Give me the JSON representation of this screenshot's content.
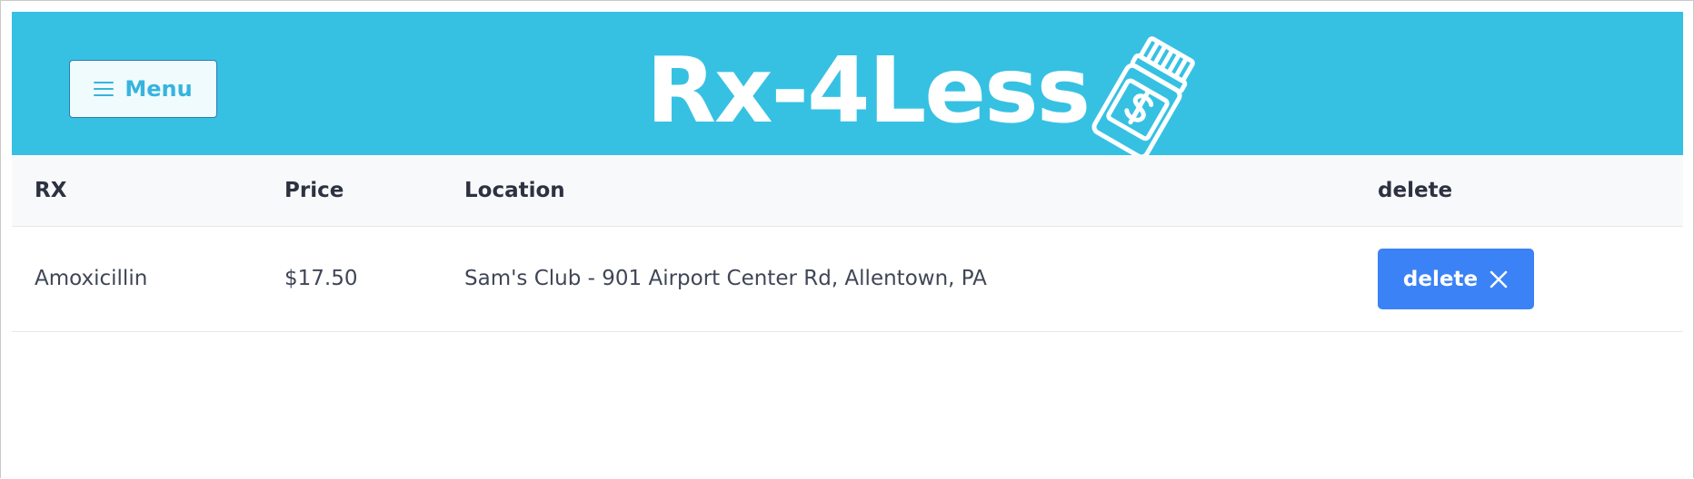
{
  "header": {
    "menu_label": "Menu",
    "brand_title": "Rx-4Less",
    "brand_icon": "pill-bottle-dollar-icon",
    "background_color": "#36c1e3"
  },
  "table": {
    "columns": [
      "RX",
      "Price",
      "Location",
      "delete"
    ],
    "rows": [
      {
        "rx": "Amoxicillin",
        "price": "$17.50",
        "location": "Sam's Club - 901 Airport Center Rd, Allentown, PA",
        "delete_label": "delete"
      }
    ]
  },
  "colors": {
    "delete_button": "#3b82f6",
    "header_bg": "#36c1e3"
  }
}
